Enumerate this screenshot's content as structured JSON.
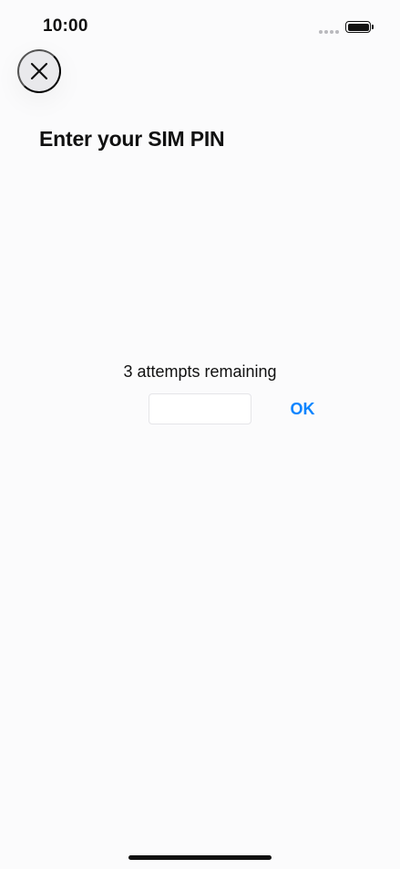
{
  "status_bar": {
    "time": "10:00"
  },
  "header": {
    "title": "Enter your SIM PIN"
  },
  "pin_entry": {
    "attempts_text": "3 attempts remaining",
    "value": "",
    "placeholder": ""
  },
  "actions": {
    "ok_label": "OK"
  },
  "icons": {
    "close": "close-icon",
    "battery": "battery-icon",
    "signal": "signal-icon"
  },
  "colors": {
    "accent": "#0a84ff"
  }
}
